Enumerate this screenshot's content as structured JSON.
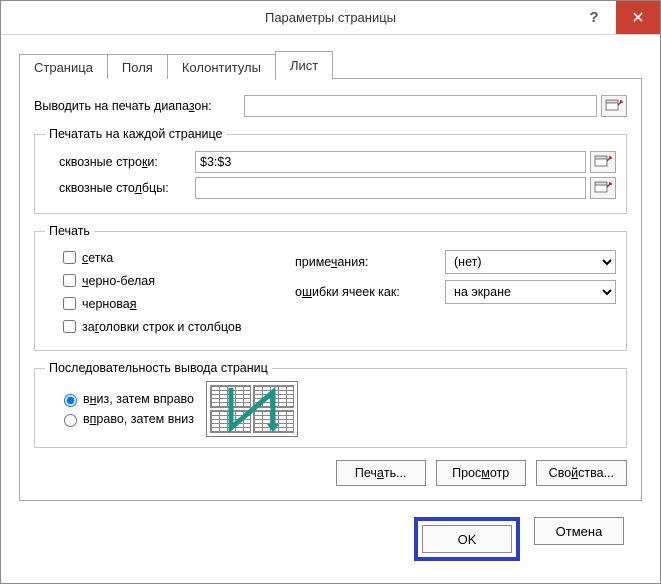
{
  "window": {
    "title": "Параметры страницы",
    "help": "?",
    "close": "✕"
  },
  "tabs": {
    "page": "Страница",
    "margins": "Поля",
    "headers": "Колонтитулы",
    "sheet": "Лист"
  },
  "output_range": {
    "label_pre": "Выводить на печать диапа",
    "label_u": "з",
    "label_post": "он:",
    "value": ""
  },
  "repeat": {
    "legend": "Печатать на каждой странице",
    "rows": {
      "label_pre": "сквозные стро",
      "label_u": "к",
      "label_post": "и:",
      "value": "$3:$3"
    },
    "cols": {
      "label_pre": "сквозные сто",
      "label_u": "л",
      "label_post": "бцы:",
      "value": ""
    }
  },
  "print": {
    "legend": "Печать",
    "grid_pre": "",
    "grid_u": "с",
    "grid_post": "етка",
    "bw_pre": "",
    "bw_u": "ч",
    "bw_post": "ерно-белая",
    "draft_pre": "черновая",
    "draft_u": "",
    "draft_post": "",
    "draft_underline": "я",
    "headings_pre": "за",
    "headings_u": "г",
    "headings_post": "оловки строк и столбцов",
    "comments_label_pre": "приме",
    "comments_label_u": "ч",
    "comments_label_post": "ания:",
    "comments_value": "(нет)",
    "errors_label_pre": "о",
    "errors_label_u": "ш",
    "errors_label_post": "ибки ячеек как:",
    "errors_value": "на экране"
  },
  "order": {
    "legend": "Последовательность вывода страниц",
    "down_pre": "в",
    "down_u": "н",
    "down_post": "из, затем вправо",
    "over_pre": "в",
    "over_u": "п",
    "over_post": "раво, затем вниз"
  },
  "actions": {
    "print_pre": "Печ",
    "print_u": "а",
    "print_post": "ть...",
    "preview_pre": "Прос",
    "preview_u": "м",
    "preview_post": "отр",
    "options_pre": "Сво",
    "options_u": "й",
    "options_post": "ства..."
  },
  "footer": {
    "ok": "OK",
    "cancel": "Отмена"
  }
}
